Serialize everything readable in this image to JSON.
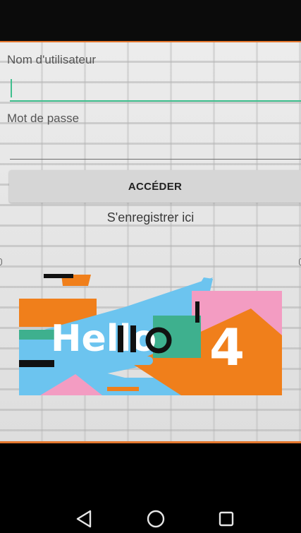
{
  "login": {
    "username_label": "Nom d'utilisateur",
    "username_value": "",
    "password_label": "Mot de passe",
    "password_value": "",
    "submit_label": "ACCÉDER",
    "register_link": "S'enregistrer ici"
  },
  "logo": {
    "text_hello": "Hello",
    "text_number": "4",
    "colors": {
      "orange": "#f07f1b",
      "blue": "#6cc4ef",
      "pink": "#f39cc2",
      "green": "#3eb08e",
      "black": "#111111"
    }
  },
  "navigation": {
    "back_icon": "back-triangle-icon",
    "home_icon": "home-circle-icon",
    "recents_icon": "recents-square-icon"
  },
  "theme": {
    "accent": "#e4772e",
    "field_focus": "#3fbf8e"
  }
}
